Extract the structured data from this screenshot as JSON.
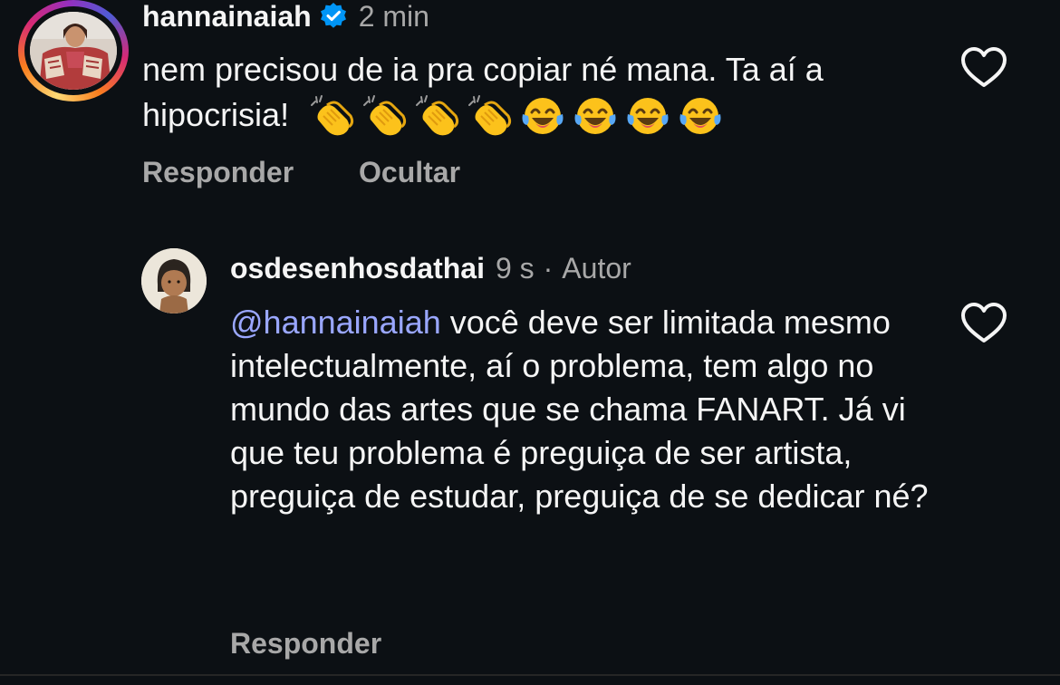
{
  "comment1": {
    "username": "hannainaiah",
    "verified": true,
    "time": "2 min",
    "text": "nem precisou de ia pra copiar né mana. Ta aí a hipocrisia!",
    "emojis": [
      "clapping-hands",
      "clapping-hands",
      "clapping-hands",
      "clapping-hands",
      "tears-of-joy",
      "tears-of-joy",
      "tears-of-joy",
      "tears-of-joy"
    ],
    "reply_label": "Responder",
    "hide_label": "Ocultar",
    "liked": false
  },
  "comment2": {
    "username": "osdesenhosdathai",
    "time": "9 s",
    "separator": "·",
    "author_badge": "Autor",
    "mention": "@hannainaiah",
    "text": "você deve ser limitada mesmo intelectualmente, aí o problema, tem algo no mundo das artes que se chama FANART. Já vi que teu problema é preguiça de ser artista, preguiça de estudar, preguiça de se dedicar né?",
    "reply_label": "Responder",
    "liked": false
  },
  "colors": {
    "background": "#0c1014",
    "text_primary": "#f5f5f5",
    "text_secondary": "#a8a8a8",
    "mention": "#9aa7ff",
    "verified_badge": "#0095f6"
  }
}
